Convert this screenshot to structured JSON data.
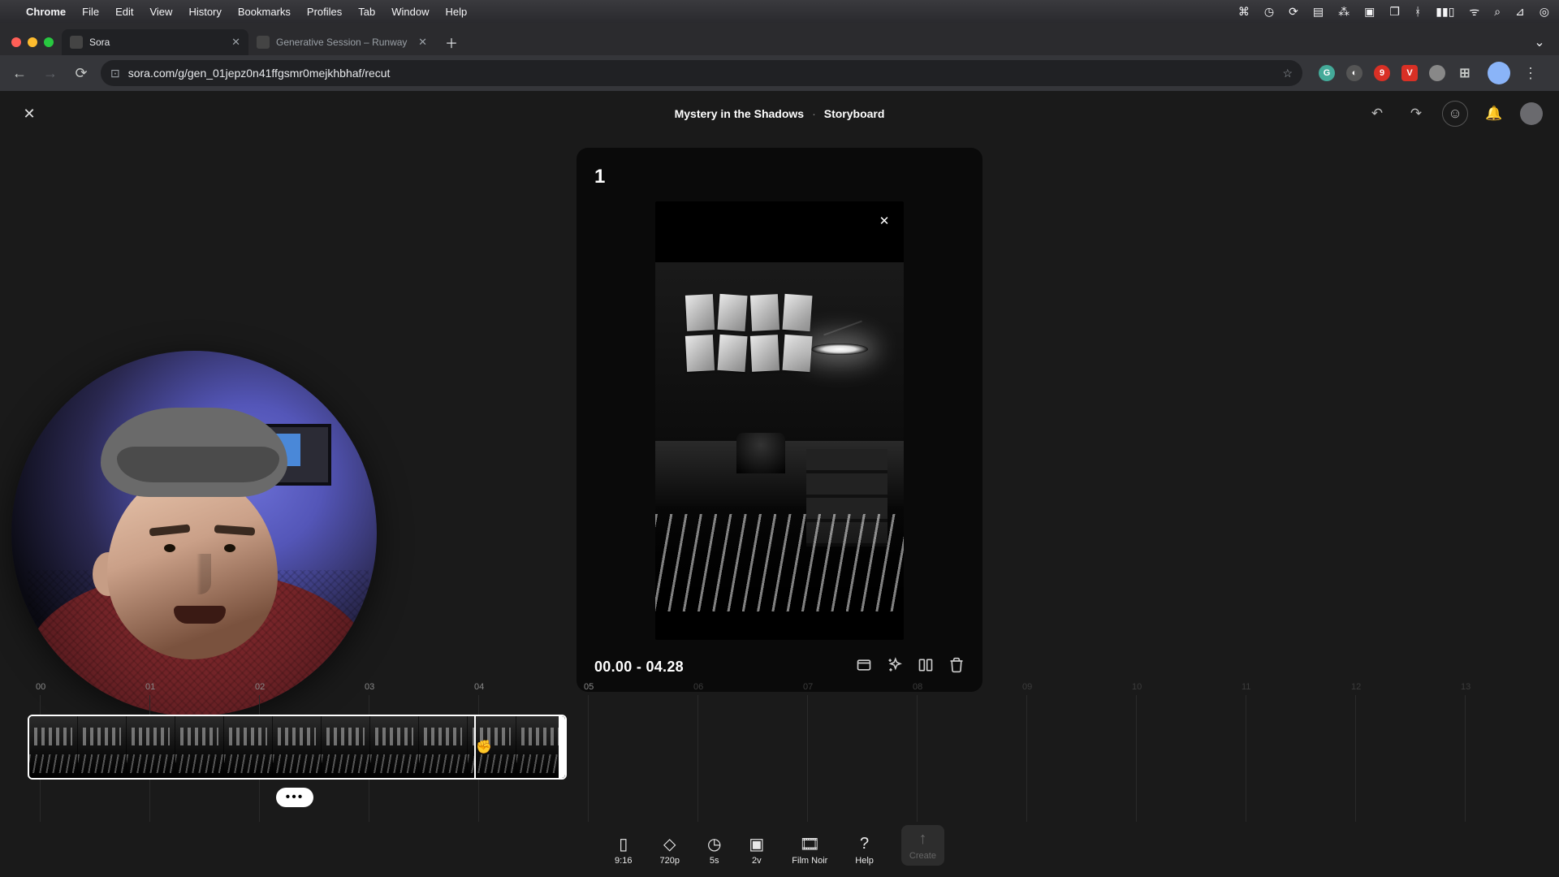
{
  "menubar": {
    "app": "Chrome",
    "items": [
      "File",
      "Edit",
      "View",
      "History",
      "Bookmarks",
      "Profiles",
      "Tab",
      "Window",
      "Help"
    ]
  },
  "tabs": [
    {
      "title": "Sora",
      "active": true
    },
    {
      "title": "Generative Session – Runway",
      "active": false
    }
  ],
  "url": "sora.com/g/gen_01jepz0n41ffgsmr0mejkhbhaf/recut",
  "header": {
    "title": "Mystery in the Shadows",
    "section": "Storyboard"
  },
  "card": {
    "number": "1",
    "timecode": "00.00 - 04.28"
  },
  "ruler": {
    "visible": [
      "00",
      "01",
      "02",
      "03",
      "04",
      "05"
    ],
    "dim": [
      "06",
      "07",
      "08",
      "09",
      "10",
      "11",
      "12",
      "13"
    ]
  },
  "bottom": {
    "aspect": "9:16",
    "res": "720p",
    "dur": "5s",
    "var": "2v",
    "style": "Film Noir",
    "help": "Help",
    "create": "Create"
  },
  "ext_badge": "9"
}
